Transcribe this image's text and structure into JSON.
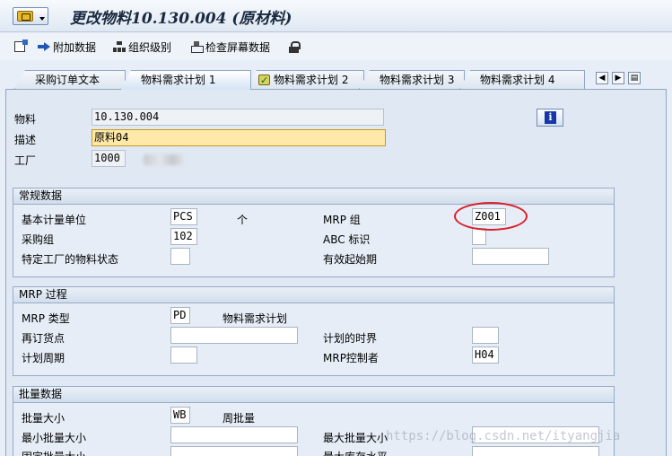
{
  "title": "更改物料10.130.004 (原材料)",
  "toolbar": {
    "additional_data": "附加数据",
    "org_levels": "组织级别",
    "check_screen_data": "检查屏幕数据"
  },
  "tabs": [
    {
      "label": "采购订单文本"
    },
    {
      "label": "物料需求计划 1"
    },
    {
      "label": "物料需求计划 2"
    },
    {
      "label": "物料需求计划 3"
    },
    {
      "label": "物料需求计划 4"
    }
  ],
  "header": {
    "material_label": "物料",
    "material_value": "10.130.004",
    "desc_label": "描述",
    "desc_value": "原料04",
    "plant_label": "工厂",
    "plant_value": "1000",
    "info_icon": "info-icon"
  },
  "general": {
    "title": "常规数据",
    "base_unit_label": "基本计量单位",
    "base_unit_value": "PCS",
    "base_unit_text": "个",
    "mrp_group_label": "MRP 组",
    "mrp_group_value": "Z001",
    "purch_group_label": "采购组",
    "purch_group_value": "102",
    "abc_label": "ABC 标识",
    "abc_value": "",
    "plant_status_label": "特定工厂的物料状态",
    "plant_status_value": "",
    "valid_from_label": "有效起始期",
    "valid_from_value": ""
  },
  "mrp_proc": {
    "title": "MRP 过程",
    "mrp_type_label": "MRP 类型",
    "mrp_type_value": "PD",
    "mrp_type_text": "物料需求计划",
    "reorder_label": "再订货点",
    "reorder_value": "",
    "plan_fence_label": "计划的时界",
    "plan_fence_value": "",
    "plan_cycle_label": "计划周期",
    "plan_cycle_value": "",
    "controller_label": "MRP控制者",
    "controller_value": "H04"
  },
  "lot": {
    "title": "批量数据",
    "lot_size_label": "批量大小",
    "lot_size_value": "WB",
    "lot_size_text": "周批量",
    "min_lot_label": "最小批量大小",
    "min_lot_value": "",
    "max_lot_label": "最大批量大小",
    "max_lot_value": "",
    "fixed_lot_label": "固定批量大小",
    "fixed_lot_value": "",
    "max_stock_label": "最大库存水平",
    "max_stock_value": ""
  },
  "watermark": "https://blog.csdn.net/ityangjia",
  "colors": {
    "accent": "#1f55b5",
    "highlight_field": "#ffe9a8",
    "annotation": "#d8202a"
  }
}
